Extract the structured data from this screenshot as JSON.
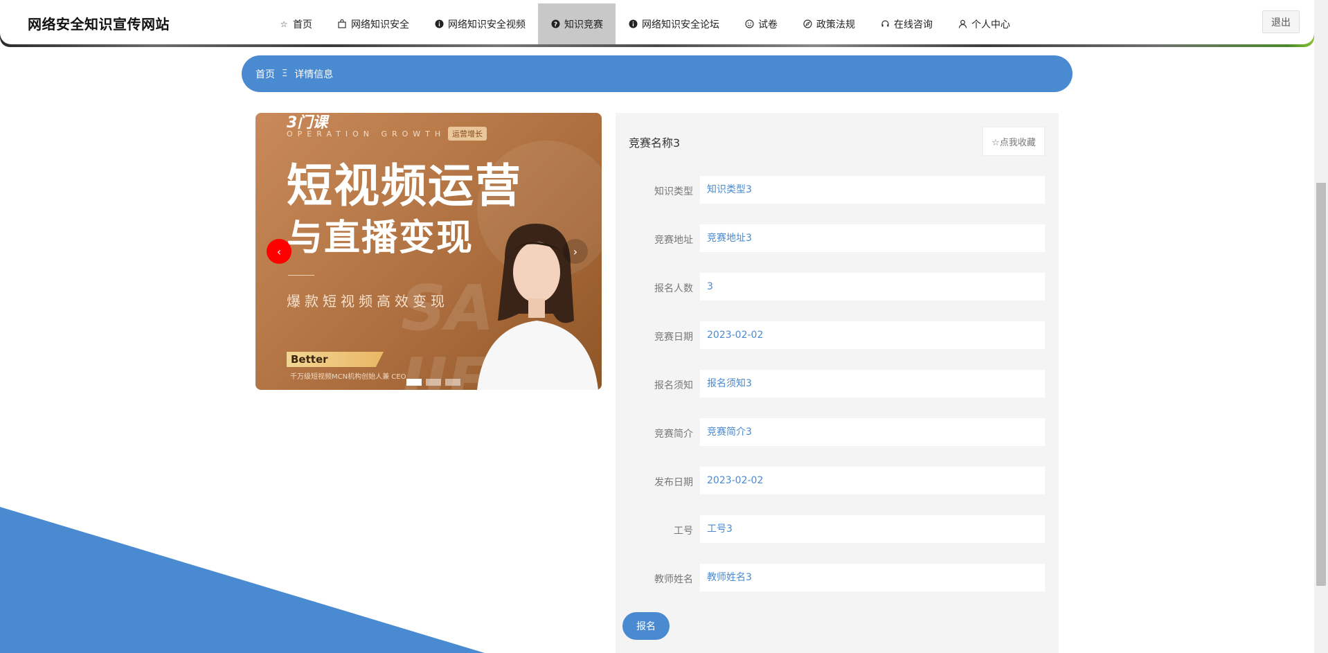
{
  "header": {
    "logo": "网络安全知识宣传网站",
    "logout_label": "退出",
    "nav": [
      {
        "label": "首页",
        "icon": "star-icon"
      },
      {
        "label": "网络知识安全",
        "icon": "bag-icon"
      },
      {
        "label": "网络知识安全视频",
        "icon": "info-icon"
      },
      {
        "label": "知识竞赛",
        "icon": "question-icon",
        "active": true
      },
      {
        "label": "网络知识安全论坛",
        "icon": "info-icon"
      },
      {
        "label": "试卷",
        "icon": "face-icon"
      },
      {
        "label": "政策法规",
        "icon": "compass-icon"
      },
      {
        "label": "在线咨询",
        "icon": "headset-icon"
      },
      {
        "label": "个人中心",
        "icon": "user-icon"
      }
    ]
  },
  "breadcrumb": {
    "home": "首页",
    "separator": "Ξ",
    "current": "详情信息"
  },
  "carousel": {
    "brand": "3门课",
    "subtitle": "OPERATION GROWTH",
    "tag": "运营增长",
    "headline1": "短视频运营",
    "headline2": "与直播变现",
    "headline3": "爆款短视频高效变现",
    "name_badge": "Better",
    "caption": "千万级短视频MCN机构创始人兼 CEO",
    "watermark": "SA JIE",
    "prev_symbol": "‹",
    "next_symbol": "›",
    "slide_count": 3,
    "active_slide": 1
  },
  "detail": {
    "title": "竞赛名称3",
    "favorite_label": "☆点我收藏",
    "fields": [
      {
        "label": "知识类型",
        "value": "知识类型3"
      },
      {
        "label": "竞赛地址",
        "value": "竞赛地址3"
      },
      {
        "label": "报名人数",
        "value": "3"
      },
      {
        "label": "竞赛日期",
        "value": "2023-02-02"
      },
      {
        "label": "报名须知",
        "value": "报名须知3"
      },
      {
        "label": "竞赛简介",
        "value": "竞赛简介3"
      },
      {
        "label": "发布日期",
        "value": "2023-02-02"
      },
      {
        "label": "工号",
        "value": "工号3"
      },
      {
        "label": "教师姓名",
        "value": "教师姓名3"
      }
    ],
    "signup_label": "报名"
  },
  "colors": {
    "accent": "#4a8ad0",
    "prev_button": "#ff0000",
    "active_nav": "#c8c8c8"
  }
}
